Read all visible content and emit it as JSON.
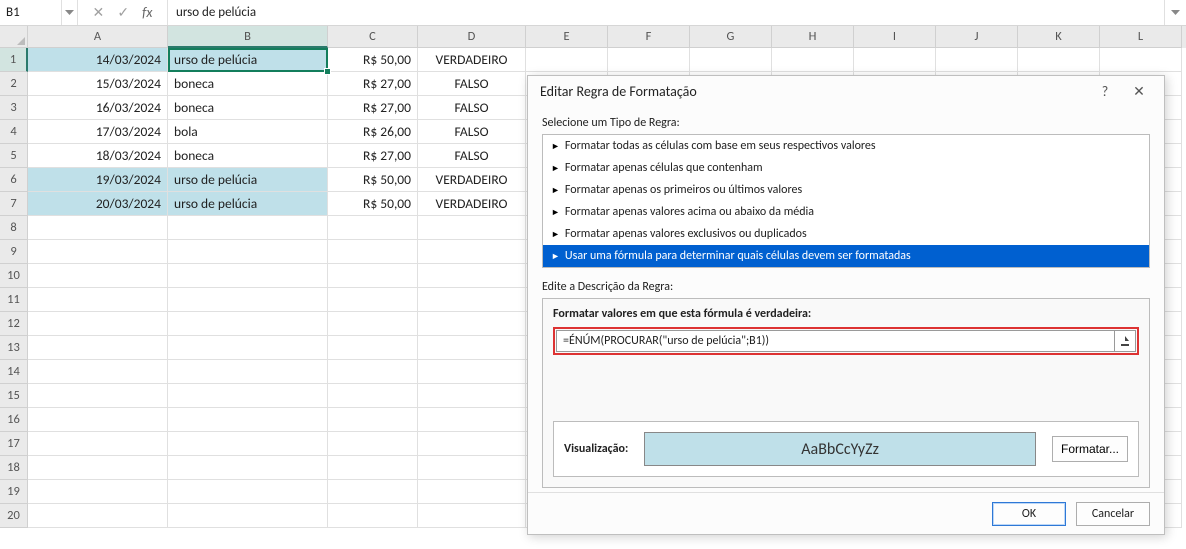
{
  "formula_bar": {
    "name_box": "B1",
    "formula": "urso de pelúcia"
  },
  "columns": [
    "A",
    "B",
    "C",
    "D",
    "E",
    "F",
    "G",
    "H",
    "I",
    "J",
    "K",
    "L"
  ],
  "active_col": "B",
  "active_row": 1,
  "grid": {
    "rows": [
      {
        "hl": true,
        "a": "14/03/2024",
        "b": "urso de pelúcia",
        "c": "R$ 50,00",
        "d": "VERDADEIRO"
      },
      {
        "hl": false,
        "a": "15/03/2024",
        "b": "boneca",
        "c": "R$ 27,00",
        "d": "FALSO"
      },
      {
        "hl": false,
        "a": "16/03/2024",
        "b": "boneca",
        "c": "R$ 27,00",
        "d": "FALSO"
      },
      {
        "hl": false,
        "a": "17/03/2024",
        "b": "bola",
        "c": "R$ 26,00",
        "d": "FALSO"
      },
      {
        "hl": false,
        "a": "18/03/2024",
        "b": "boneca",
        "c": "R$ 27,00",
        "d": "FALSO"
      },
      {
        "hl": true,
        "a": "19/03/2024",
        "b": "urso de pelúcia",
        "c": "R$ 50,00",
        "d": "VERDADEIRO"
      },
      {
        "hl": true,
        "a": "20/03/2024",
        "b": "urso de pelúcia",
        "c": "R$ 50,00",
        "d": "VERDADEIRO"
      }
    ],
    "empty_rows": 13
  },
  "dialog": {
    "title": "Editar Regra de Formatação",
    "section1": "Selecione um Tipo de Regra:",
    "rules": [
      "Formatar todas as células com base em seus respectivos valores",
      "Formatar apenas células que contenham",
      "Formatar apenas os primeiros ou últimos valores",
      "Formatar apenas valores acima ou abaixo da média",
      "Formatar apenas valores exclusivos ou duplicados",
      "Usar uma fórmula para determinar quais células devem ser formatadas"
    ],
    "selected_rule": 5,
    "section2": "Edite a Descrição da Regra:",
    "formula_label": "Formatar valores em que esta fórmula é verdadeira:",
    "formula_value": "=ÉNÚM(PROCURAR(\"urso de pelúcia\";B1))",
    "preview_label": "Visualização:",
    "preview_sample": "AaBbCcYyZz",
    "format_btn": "Formatar...",
    "ok": "OK",
    "cancel": "Cancelar",
    "help": "?"
  }
}
